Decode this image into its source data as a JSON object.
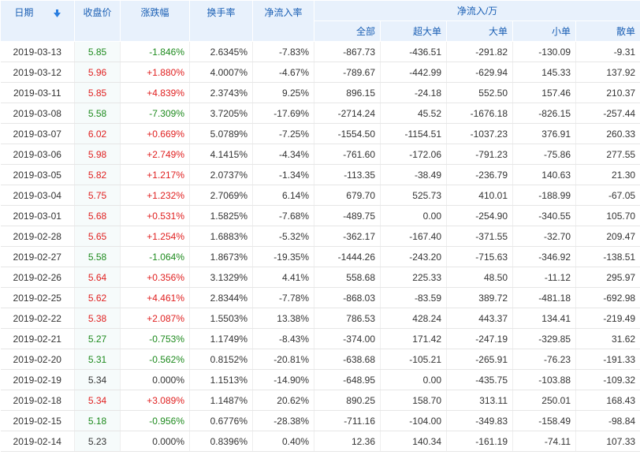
{
  "headers": {
    "date": "日期",
    "close": "收盘价",
    "change": "涨跌幅",
    "turnover": "换手率",
    "net_rate": "净流入率",
    "net_group": "净流入/万",
    "all": "全部",
    "super": "超大单",
    "large": "大单",
    "small": "小单",
    "retail": "散单"
  },
  "icons": {
    "sort": "sort-down-arrow-icon"
  },
  "colors": {
    "up": "#e02020",
    "down": "#1d8a1d",
    "header_bg": "#e8f1fc",
    "header_text": "#1a5fb4"
  },
  "rows": [
    {
      "date": "2019-03-13",
      "close": "5.85",
      "change": "-1.846%",
      "turnover": "2.6345%",
      "net_rate": "-7.83%",
      "all": "-867.73",
      "super": "-436.51",
      "large": "-291.82",
      "small": "-130.09",
      "retail": "-9.31",
      "dir": "down"
    },
    {
      "date": "2019-03-12",
      "close": "5.96",
      "change": "+1.880%",
      "turnover": "4.0007%",
      "net_rate": "-4.67%",
      "all": "-789.67",
      "super": "-442.99",
      "large": "-629.94",
      "small": "145.33",
      "retail": "137.92",
      "dir": "up"
    },
    {
      "date": "2019-03-11",
      "close": "5.85",
      "change": "+4.839%",
      "turnover": "2.3743%",
      "net_rate": "9.25%",
      "all": "896.15",
      "super": "-24.18",
      "large": "552.50",
      "small": "157.46",
      "retail": "210.37",
      "dir": "up"
    },
    {
      "date": "2019-03-08",
      "close": "5.58",
      "change": "-7.309%",
      "turnover": "3.7205%",
      "net_rate": "-17.69%",
      "all": "-2714.24",
      "super": "45.52",
      "large": "-1676.18",
      "small": "-826.15",
      "retail": "-257.44",
      "dir": "down"
    },
    {
      "date": "2019-03-07",
      "close": "6.02",
      "change": "+0.669%",
      "turnover": "5.0789%",
      "net_rate": "-7.25%",
      "all": "-1554.50",
      "super": "-1154.51",
      "large": "-1037.23",
      "small": "376.91",
      "retail": "260.33",
      "dir": "up"
    },
    {
      "date": "2019-03-06",
      "close": "5.98",
      "change": "+2.749%",
      "turnover": "4.1415%",
      "net_rate": "-4.34%",
      "all": "-761.60",
      "super": "-172.06",
      "large": "-791.23",
      "small": "-75.86",
      "retail": "277.55",
      "dir": "up"
    },
    {
      "date": "2019-03-05",
      "close": "5.82",
      "change": "+1.217%",
      "turnover": "2.0737%",
      "net_rate": "-1.34%",
      "all": "-113.35",
      "super": "-38.49",
      "large": "-236.79",
      "small": "140.63",
      "retail": "21.30",
      "dir": "up"
    },
    {
      "date": "2019-03-04",
      "close": "5.75",
      "change": "+1.232%",
      "turnover": "2.7069%",
      "net_rate": "6.14%",
      "all": "679.70",
      "super": "525.73",
      "large": "410.01",
      "small": "-188.99",
      "retail": "-67.05",
      "dir": "up"
    },
    {
      "date": "2019-03-01",
      "close": "5.68",
      "change": "+0.531%",
      "turnover": "1.5825%",
      "net_rate": "-7.68%",
      "all": "-489.75",
      "super": "0.00",
      "large": "-254.90",
      "small": "-340.55",
      "retail": "105.70",
      "dir": "up"
    },
    {
      "date": "2019-02-28",
      "close": "5.65",
      "change": "+1.254%",
      "turnover": "1.6883%",
      "net_rate": "-5.32%",
      "all": "-362.17",
      "super": "-167.40",
      "large": "-371.55",
      "small": "-32.70",
      "retail": "209.47",
      "dir": "up"
    },
    {
      "date": "2019-02-27",
      "close": "5.58",
      "change": "-1.064%",
      "turnover": "1.8673%",
      "net_rate": "-19.35%",
      "all": "-1444.26",
      "super": "-243.20",
      "large": "-715.63",
      "small": "-346.92",
      "retail": "-138.51",
      "dir": "down"
    },
    {
      "date": "2019-02-26",
      "close": "5.64",
      "change": "+0.356%",
      "turnover": "3.1329%",
      "net_rate": "4.41%",
      "all": "558.68",
      "super": "225.33",
      "large": "48.50",
      "small": "-11.12",
      "retail": "295.97",
      "dir": "up"
    },
    {
      "date": "2019-02-25",
      "close": "5.62",
      "change": "+4.461%",
      "turnover": "2.8344%",
      "net_rate": "-7.78%",
      "all": "-868.03",
      "super": "-83.59",
      "large": "389.72",
      "small": "-481.18",
      "retail": "-692.98",
      "dir": "up"
    },
    {
      "date": "2019-02-22",
      "close": "5.38",
      "change": "+2.087%",
      "turnover": "1.5503%",
      "net_rate": "13.38%",
      "all": "786.53",
      "super": "428.24",
      "large": "443.37",
      "small": "134.41",
      "retail": "-219.49",
      "dir": "up"
    },
    {
      "date": "2019-02-21",
      "close": "5.27",
      "change": "-0.753%",
      "turnover": "1.1749%",
      "net_rate": "-8.43%",
      "all": "-374.00",
      "super": "171.42",
      "large": "-247.19",
      "small": "-329.85",
      "retail": "31.62",
      "dir": "down"
    },
    {
      "date": "2019-02-20",
      "close": "5.31",
      "change": "-0.562%",
      "turnover": "0.8152%",
      "net_rate": "-20.81%",
      "all": "-638.68",
      "super": "-105.21",
      "large": "-265.91",
      "small": "-76.23",
      "retail": "-191.33",
      "dir": "down"
    },
    {
      "date": "2019-02-19",
      "close": "5.34",
      "change": "0.000%",
      "turnover": "1.1513%",
      "net_rate": "-14.90%",
      "all": "-648.95",
      "super": "0.00",
      "large": "-435.75",
      "small": "-103.88",
      "retail": "-109.32",
      "dir": "flat"
    },
    {
      "date": "2019-02-18",
      "close": "5.34",
      "change": "+3.089%",
      "turnover": "1.1487%",
      "net_rate": "20.62%",
      "all": "890.25",
      "super": "158.70",
      "large": "313.11",
      "small": "250.01",
      "retail": "168.43",
      "dir": "up"
    },
    {
      "date": "2019-02-15",
      "close": "5.18",
      "change": "-0.956%",
      "turnover": "0.6776%",
      "net_rate": "-28.38%",
      "all": "-711.16",
      "super": "-104.00",
      "large": "-349.83",
      "small": "-158.49",
      "retail": "-98.84",
      "dir": "down"
    },
    {
      "date": "2019-02-14",
      "close": "5.23",
      "change": "0.000%",
      "turnover": "0.8396%",
      "net_rate": "0.40%",
      "all": "12.36",
      "super": "140.34",
      "large": "-161.19",
      "small": "-74.11",
      "retail": "107.33",
      "dir": "flat"
    }
  ]
}
